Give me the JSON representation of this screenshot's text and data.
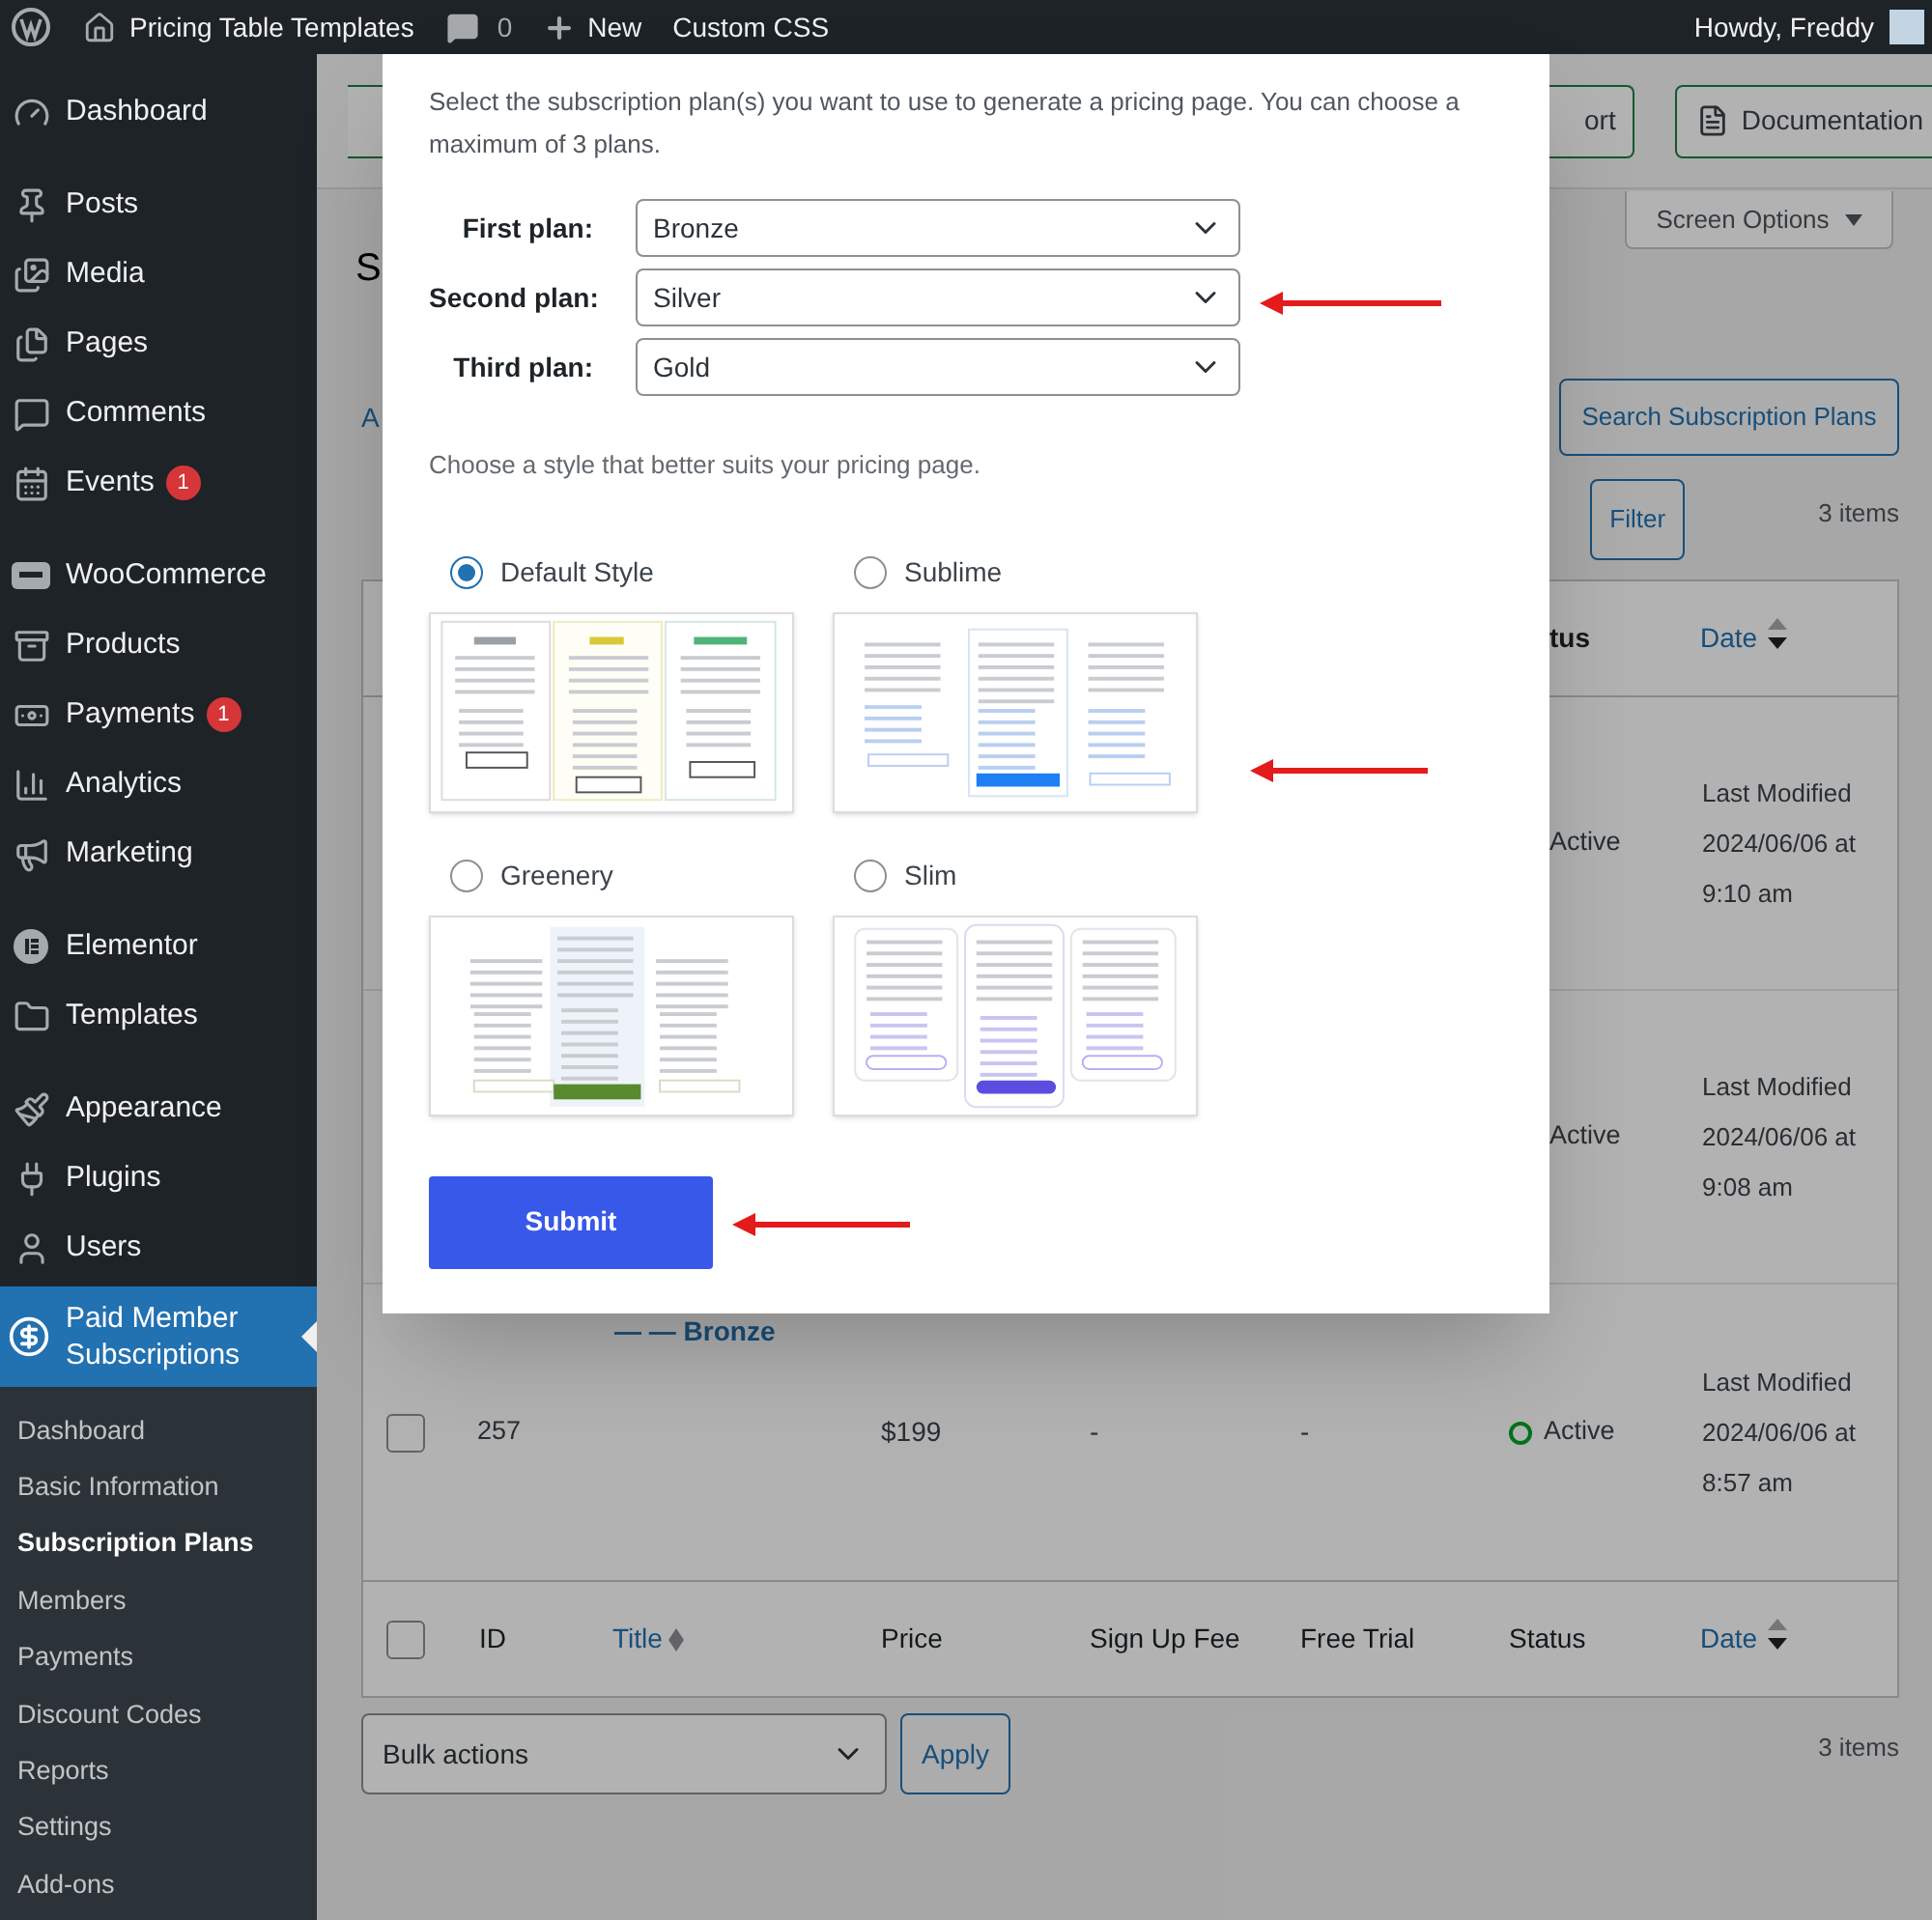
{
  "admin_bar": {
    "site_name": "Pricing Table Templates",
    "comments_count": "0",
    "new_label": "New",
    "custom_css": "Custom CSS",
    "greeting": "Howdy, Freddy"
  },
  "sidebar": {
    "groups": [
      {
        "items": [
          {
            "label": "Dashboard",
            "selected": false
          }
        ]
      },
      {
        "items": [
          {
            "label": "Posts",
            "selected": false
          },
          {
            "label": "Media",
            "selected": false
          },
          {
            "label": "Pages",
            "selected": false
          },
          {
            "label": "Comments",
            "selected": false
          },
          {
            "label": "Events",
            "badge": "1",
            "selected": false
          }
        ]
      },
      {
        "items": [
          {
            "label": "WooCommerce",
            "selected": false
          },
          {
            "label": "Products",
            "selected": false
          },
          {
            "label": "Payments",
            "badge": "1",
            "selected": false
          },
          {
            "label": "Analytics",
            "selected": false
          },
          {
            "label": "Marketing",
            "selected": false
          }
        ]
      },
      {
        "items": [
          {
            "label": "Elementor",
            "selected": false
          },
          {
            "label": "Templates",
            "selected": false
          }
        ]
      },
      {
        "items": [
          {
            "label": "Appearance",
            "selected": false
          },
          {
            "label": "Plugins",
            "selected": false
          },
          {
            "label": "Users",
            "selected": false
          },
          {
            "label": "Paid Member Subscriptions",
            "selected": true
          }
        ]
      }
    ],
    "submenu": [
      {
        "label": "Dashboard",
        "selected": false
      },
      {
        "label": "Basic Information",
        "selected": false
      },
      {
        "label": "Subscription Plans",
        "selected": true
      },
      {
        "label": "Members",
        "selected": false
      },
      {
        "label": "Payments",
        "selected": false
      },
      {
        "label": "Discount Codes",
        "selected": false
      },
      {
        "label": "Reports",
        "selected": false
      },
      {
        "label": "Settings",
        "selected": false
      },
      {
        "label": "Add-ons",
        "selected": false
      }
    ]
  },
  "page": {
    "header_buttons": [
      "ort",
      "Documentation"
    ],
    "screen_options": "Screen Options",
    "title_fragment": "S",
    "link_fragment": "A",
    "search_button": "Search Subscription Plans",
    "filter_button": "Filter",
    "items_count_top": "3 items",
    "table": {
      "header": {
        "status": "tus",
        "date": "Date"
      },
      "rows": [
        {
          "kind": "covered",
          "status": "Active",
          "date": "Last Modified 2024/06/06 at 9:10 am"
        },
        {
          "kind": "covered",
          "status": "Active",
          "date": "Last Modified 2024/06/06 at 9:08 am"
        },
        {
          "kind": "full",
          "checked": false,
          "id": "257",
          "title": "— — Bronze",
          "price": "$199",
          "signup_fee": "-",
          "free_trial": "-",
          "status": "Active",
          "date": "Last Modified 2024/06/06 at 8:57 am"
        }
      ],
      "select_all": {
        "checked": false
      },
      "footer_columns": [
        "ID",
        "Title",
        "Price",
        "Sign Up Fee",
        "Free Trial",
        "Status",
        "Date"
      ]
    },
    "bulk_actions": {
      "value": "Bulk actions"
    },
    "apply_button": "Apply",
    "items_count_bottom": "3 items"
  },
  "modal": {
    "intro": "Select the subscription plan(s) you want to use to generate a pricing page. You can choose a maximum of 3 plans.",
    "plans": [
      {
        "label": "First plan:",
        "value": "Bronze"
      },
      {
        "label": "Second plan:",
        "value": "Silver"
      },
      {
        "label": "Third plan:",
        "value": "Gold"
      }
    ],
    "style_prompt": "Choose a style that better suits your pricing page.",
    "styles": [
      {
        "label": "Default Style",
        "kind": "default",
        "selected": true
      },
      {
        "label": "Sublime",
        "kind": "sublime",
        "selected": false
      },
      {
        "label": "Greenery",
        "kind": "greenery",
        "selected": false
      },
      {
        "label": "Slim",
        "kind": "slim",
        "selected": false
      }
    ],
    "submit": "Submit"
  }
}
